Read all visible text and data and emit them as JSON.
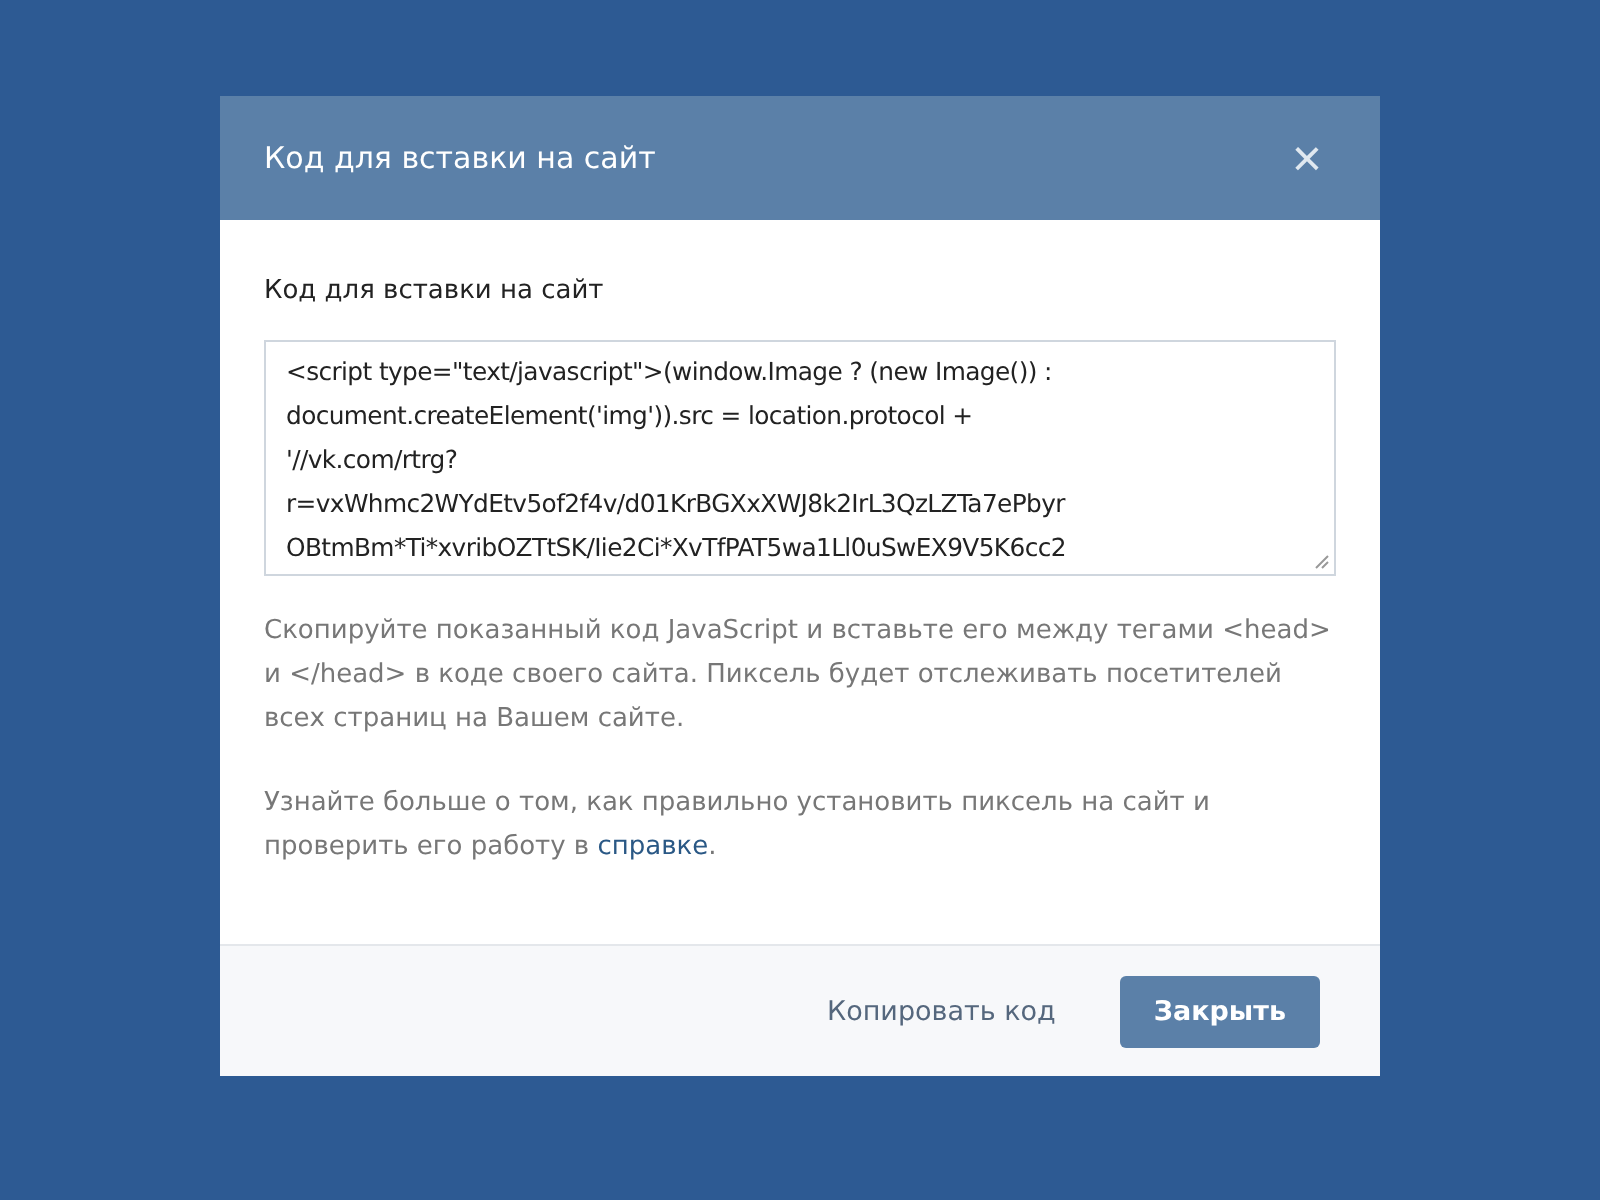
{
  "dialog": {
    "title": "Код для вставки на сайт",
    "close_icon": "×"
  },
  "section_title": "Код для вставки на сайт",
  "code_lines": [
    "<script type=\"text/javascript\">(window.Image ? (new Image()) :",
    "document.createElement('img')).src = location.protocol +",
    "'//vk.com/rtrg?",
    "r=vxWhmc2WYdEtv5of2f4v/d01KrBGXxXWJ8k2IrL3QzLZTa7ePbyr",
    "OBtmBm*Ti*xvribOZTtSK/Iie2Ci*XvTfPAT5wa1Ll0uSwEX9V5K6cc2"
  ],
  "description": "Скопируйте показанный код JavaScript и вставьте его между тегами <head> и </head> в коде своего сайта. Пиксель будет отслеживать посетителей всех страниц на Вашем сайте.",
  "help": {
    "text_before": "Узнайте больше о том, как правильно установить пиксель на сайт и проверить его работу в ",
    "link": "справке",
    "text_after": "."
  },
  "buttons": [
    {
      "label": "Копировать код",
      "kind": "link"
    },
    {
      "label": "Закрыть",
      "kind": "primary"
    }
  ]
}
